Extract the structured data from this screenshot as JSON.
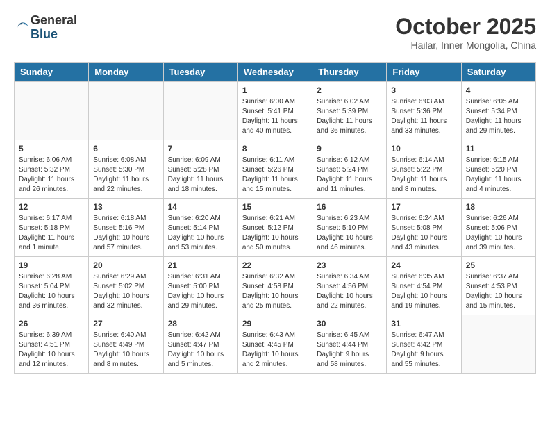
{
  "header": {
    "logo": {
      "general": "General",
      "blue": "Blue"
    },
    "title": "October 2025",
    "subtitle": "Hailar, Inner Mongolia, China"
  },
  "columns": [
    "Sunday",
    "Monday",
    "Tuesday",
    "Wednesday",
    "Thursday",
    "Friday",
    "Saturday"
  ],
  "weeks": [
    [
      {
        "day": "",
        "empty": true
      },
      {
        "day": "",
        "empty": true
      },
      {
        "day": "",
        "empty": true
      },
      {
        "day": "1",
        "sunrise": "Sunrise: 6:00 AM",
        "sunset": "Sunset: 5:41 PM",
        "daylight": "Daylight: 11 hours and 40 minutes."
      },
      {
        "day": "2",
        "sunrise": "Sunrise: 6:02 AM",
        "sunset": "Sunset: 5:39 PM",
        "daylight": "Daylight: 11 hours and 36 minutes."
      },
      {
        "day": "3",
        "sunrise": "Sunrise: 6:03 AM",
        "sunset": "Sunset: 5:36 PM",
        "daylight": "Daylight: 11 hours and 33 minutes."
      },
      {
        "day": "4",
        "sunrise": "Sunrise: 6:05 AM",
        "sunset": "Sunset: 5:34 PM",
        "daylight": "Daylight: 11 hours and 29 minutes."
      }
    ],
    [
      {
        "day": "5",
        "sunrise": "Sunrise: 6:06 AM",
        "sunset": "Sunset: 5:32 PM",
        "daylight": "Daylight: 11 hours and 26 minutes."
      },
      {
        "day": "6",
        "sunrise": "Sunrise: 6:08 AM",
        "sunset": "Sunset: 5:30 PM",
        "daylight": "Daylight: 11 hours and 22 minutes."
      },
      {
        "day": "7",
        "sunrise": "Sunrise: 6:09 AM",
        "sunset": "Sunset: 5:28 PM",
        "daylight": "Daylight: 11 hours and 18 minutes."
      },
      {
        "day": "8",
        "sunrise": "Sunrise: 6:11 AM",
        "sunset": "Sunset: 5:26 PM",
        "daylight": "Daylight: 11 hours and 15 minutes."
      },
      {
        "day": "9",
        "sunrise": "Sunrise: 6:12 AM",
        "sunset": "Sunset: 5:24 PM",
        "daylight": "Daylight: 11 hours and 11 minutes."
      },
      {
        "day": "10",
        "sunrise": "Sunrise: 6:14 AM",
        "sunset": "Sunset: 5:22 PM",
        "daylight": "Daylight: 11 hours and 8 minutes."
      },
      {
        "day": "11",
        "sunrise": "Sunrise: 6:15 AM",
        "sunset": "Sunset: 5:20 PM",
        "daylight": "Daylight: 11 hours and 4 minutes."
      }
    ],
    [
      {
        "day": "12",
        "sunrise": "Sunrise: 6:17 AM",
        "sunset": "Sunset: 5:18 PM",
        "daylight": "Daylight: 11 hours and 1 minute."
      },
      {
        "day": "13",
        "sunrise": "Sunrise: 6:18 AM",
        "sunset": "Sunset: 5:16 PM",
        "daylight": "Daylight: 10 hours and 57 minutes."
      },
      {
        "day": "14",
        "sunrise": "Sunrise: 6:20 AM",
        "sunset": "Sunset: 5:14 PM",
        "daylight": "Daylight: 10 hours and 53 minutes."
      },
      {
        "day": "15",
        "sunrise": "Sunrise: 6:21 AM",
        "sunset": "Sunset: 5:12 PM",
        "daylight": "Daylight: 10 hours and 50 minutes."
      },
      {
        "day": "16",
        "sunrise": "Sunrise: 6:23 AM",
        "sunset": "Sunset: 5:10 PM",
        "daylight": "Daylight: 10 hours and 46 minutes."
      },
      {
        "day": "17",
        "sunrise": "Sunrise: 6:24 AM",
        "sunset": "Sunset: 5:08 PM",
        "daylight": "Daylight: 10 hours and 43 minutes."
      },
      {
        "day": "18",
        "sunrise": "Sunrise: 6:26 AM",
        "sunset": "Sunset: 5:06 PM",
        "daylight": "Daylight: 10 hours and 39 minutes."
      }
    ],
    [
      {
        "day": "19",
        "sunrise": "Sunrise: 6:28 AM",
        "sunset": "Sunset: 5:04 PM",
        "daylight": "Daylight: 10 hours and 36 minutes."
      },
      {
        "day": "20",
        "sunrise": "Sunrise: 6:29 AM",
        "sunset": "Sunset: 5:02 PM",
        "daylight": "Daylight: 10 hours and 32 minutes."
      },
      {
        "day": "21",
        "sunrise": "Sunrise: 6:31 AM",
        "sunset": "Sunset: 5:00 PM",
        "daylight": "Daylight: 10 hours and 29 minutes."
      },
      {
        "day": "22",
        "sunrise": "Sunrise: 6:32 AM",
        "sunset": "Sunset: 4:58 PM",
        "daylight": "Daylight: 10 hours and 25 minutes."
      },
      {
        "day": "23",
        "sunrise": "Sunrise: 6:34 AM",
        "sunset": "Sunset: 4:56 PM",
        "daylight": "Daylight: 10 hours and 22 minutes."
      },
      {
        "day": "24",
        "sunrise": "Sunrise: 6:35 AM",
        "sunset": "Sunset: 4:54 PM",
        "daylight": "Daylight: 10 hours and 19 minutes."
      },
      {
        "day": "25",
        "sunrise": "Sunrise: 6:37 AM",
        "sunset": "Sunset: 4:53 PM",
        "daylight": "Daylight: 10 hours and 15 minutes."
      }
    ],
    [
      {
        "day": "26",
        "sunrise": "Sunrise: 6:39 AM",
        "sunset": "Sunset: 4:51 PM",
        "daylight": "Daylight: 10 hours and 12 minutes."
      },
      {
        "day": "27",
        "sunrise": "Sunrise: 6:40 AM",
        "sunset": "Sunset: 4:49 PM",
        "daylight": "Daylight: 10 hours and 8 minutes."
      },
      {
        "day": "28",
        "sunrise": "Sunrise: 6:42 AM",
        "sunset": "Sunset: 4:47 PM",
        "daylight": "Daylight: 10 hours and 5 minutes."
      },
      {
        "day": "29",
        "sunrise": "Sunrise: 6:43 AM",
        "sunset": "Sunset: 4:45 PM",
        "daylight": "Daylight: 10 hours and 2 minutes."
      },
      {
        "day": "30",
        "sunrise": "Sunrise: 6:45 AM",
        "sunset": "Sunset: 4:44 PM",
        "daylight": "Daylight: 9 hours and 58 minutes."
      },
      {
        "day": "31",
        "sunrise": "Sunrise: 6:47 AM",
        "sunset": "Sunset: 4:42 PM",
        "daylight": "Daylight: 9 hours and 55 minutes."
      },
      {
        "day": "",
        "empty": true
      }
    ]
  ]
}
